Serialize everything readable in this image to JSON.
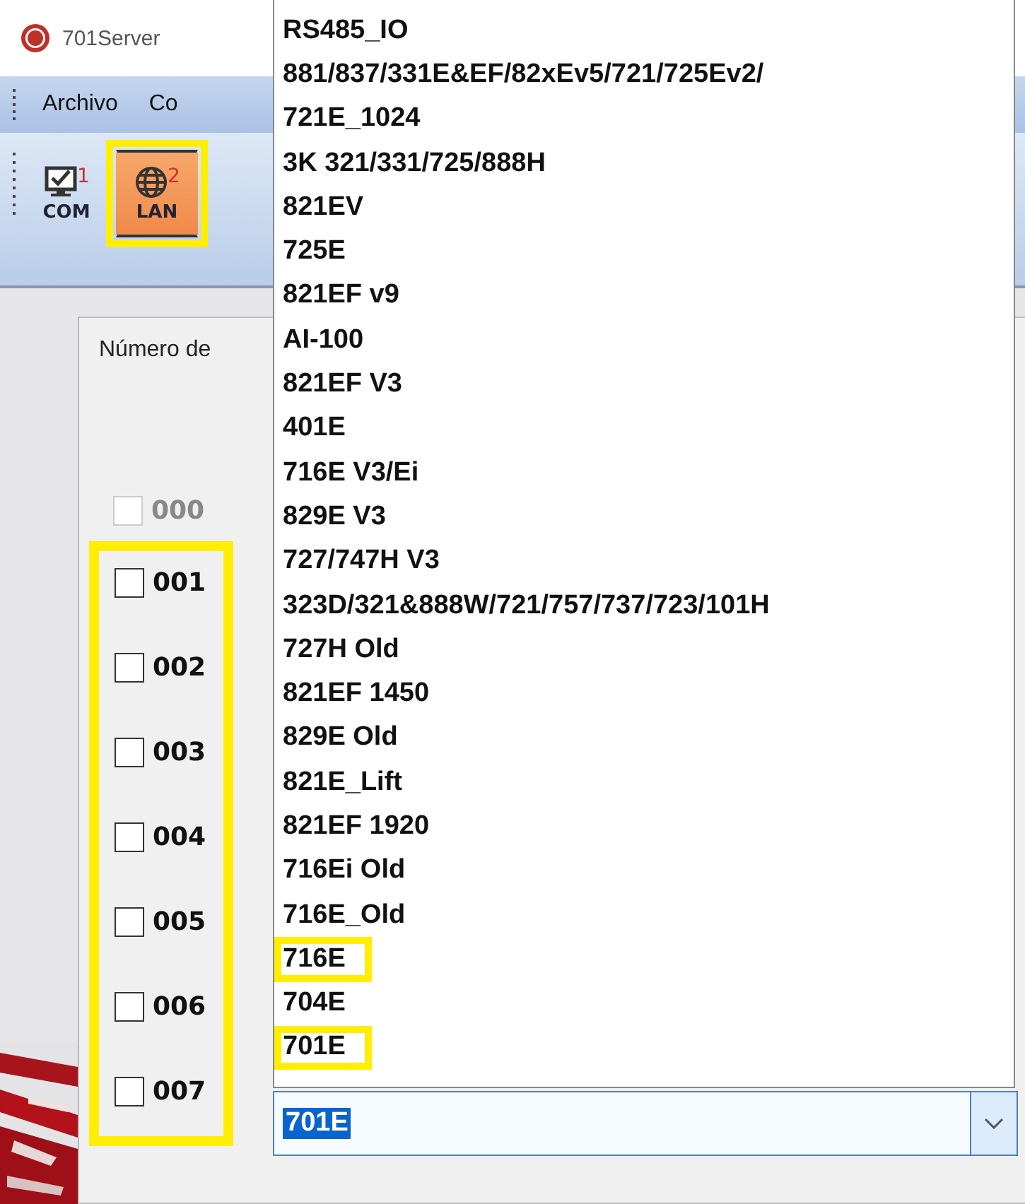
{
  "window": {
    "title": "701Server"
  },
  "menu": [
    "Archivo",
    "Co"
  ],
  "toolbar": [
    {
      "kind": "monitor",
      "number": "1",
      "label": "COM",
      "selected": false,
      "highlighted": false
    },
    {
      "kind": "globe",
      "number": "2",
      "label": "LAN",
      "selected": true,
      "highlighted": true
    }
  ],
  "dialog": {
    "heading": "Número de",
    "checkboxes": [
      {
        "label": "000",
        "checked": false,
        "disabled": true
      }
    ],
    "highlighted_checkboxes": [
      {
        "label": "001",
        "checked": false,
        "disabled": false
      },
      {
        "label": "002",
        "checked": false,
        "disabled": false
      },
      {
        "label": "003",
        "checked": false,
        "disabled": false
      },
      {
        "label": "004",
        "checked": false,
        "disabled": false
      },
      {
        "label": "005",
        "checked": false,
        "disabled": false
      },
      {
        "label": "006",
        "checked": false,
        "disabled": false
      },
      {
        "label": "007",
        "checked": false,
        "disabled": false
      }
    ]
  },
  "dropdown": {
    "value": "701E",
    "options": [
      {
        "label": "RS485_IO",
        "highlighted": false
      },
      {
        "label": "881/837/331E&EF/82xEv5/721/725Ev2/",
        "highlighted": false
      },
      {
        "label": "721E_1024",
        "highlighted": false
      },
      {
        "label": "3K 321/331/725/888H",
        "highlighted": false
      },
      {
        "label": "821EV",
        "highlighted": false
      },
      {
        "label": "725E",
        "highlighted": false
      },
      {
        "label": "821EF v9",
        "highlighted": false
      },
      {
        "label": "AI-100",
        "highlighted": false
      },
      {
        "label": "821EF V3",
        "highlighted": false
      },
      {
        "label": "401E",
        "highlighted": false
      },
      {
        "label": "716E V3/Ei",
        "highlighted": false
      },
      {
        "label": "829E V3",
        "highlighted": false
      },
      {
        "label": "727/747H V3",
        "highlighted": false
      },
      {
        "label": "323D/321&888W/721/757/737/723/101H",
        "highlighted": false
      },
      {
        "label": "727H Old",
        "highlighted": false
      },
      {
        "label": "821EF 1450",
        "highlighted": false
      },
      {
        "label": "829E Old",
        "highlighted": false
      },
      {
        "label": "821E_Lift",
        "highlighted": false
      },
      {
        "label": "821EF 1920",
        "highlighted": false
      },
      {
        "label": "716Ei Old",
        "highlighted": false
      },
      {
        "label": "716E_Old",
        "highlighted": false
      },
      {
        "label": "716E",
        "highlighted": true
      },
      {
        "label": "704E",
        "highlighted": false
      },
      {
        "label": "701E",
        "highlighted": true
      }
    ]
  }
}
